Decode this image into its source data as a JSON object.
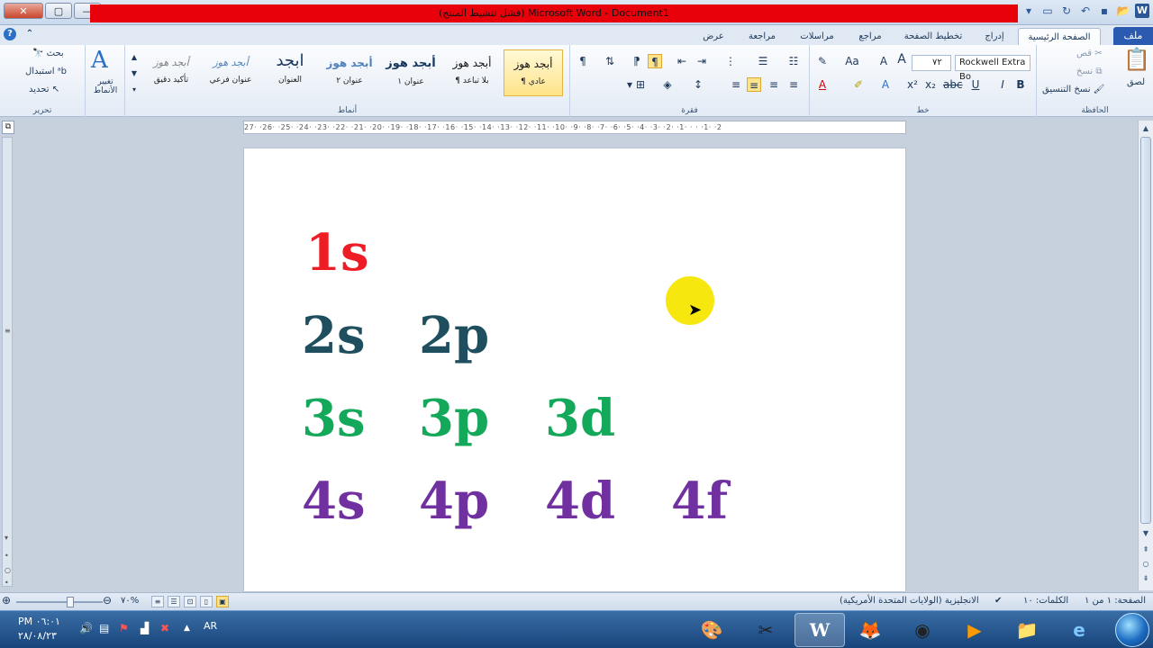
{
  "window": {
    "title": "(فشل تنشيط المنتج) Microsoft Word - Document1",
    "controls": [
      "✕",
      "▢",
      "—"
    ]
  },
  "tabs": {
    "file": "ملف",
    "home": "الصفحة الرئيسية",
    "insert": "إدراج",
    "layout": "تخطيط الصفحة",
    "references": "مراجع",
    "mailings": "مراسلات",
    "review": "مراجعة",
    "view": "عرض"
  },
  "ribbon": {
    "clipboard": {
      "label": "الحافظة",
      "paste": "لصق",
      "cut": "قص",
      "copy": "نسخ",
      "format_painter": "نسخ التنسيق"
    },
    "font": {
      "label": "خط",
      "name": "Rockwell Extra Bo",
      "size": "٧٢"
    },
    "paragraph": {
      "label": "فقرة"
    },
    "styles": {
      "label": "أنماط",
      "items": [
        {
          "preview": "أبجد هوز",
          "name": "¶ عادي"
        },
        {
          "preview": "أبجد هوز",
          "name": "¶ بلا تباعد"
        },
        {
          "preview": "أبجد هوز",
          "name": "عنوان ١"
        },
        {
          "preview": "أبجد هوز",
          "name": "عنوان ٢"
        },
        {
          "preview": "ابجد",
          "name": "العنوان"
        },
        {
          "preview": "أبجد هوز",
          "name": "عنوان فرعي"
        },
        {
          "preview": "أبجد هوز",
          "name": "تأكيد دقيق"
        }
      ],
      "change_styles": "تغيير الأنماط"
    },
    "editing": {
      "label": "تحرير",
      "find": "بحث",
      "replace": "استبدال",
      "select": "تحديد"
    }
  },
  "document": {
    "orbitals": [
      {
        "text": "1s",
        "color": "#ee1c25"
      },
      {
        "text": "2s",
        "color": "#1f4f5f"
      },
      {
        "text": "2p",
        "color": "#1f4f5f"
      },
      {
        "text": "3s",
        "color": "#14a95a"
      },
      {
        "text": "3p",
        "color": "#14a95a"
      },
      {
        "text": "3d",
        "color": "#14a95a"
      },
      {
        "text": "4s",
        "color": "#7030a0"
      },
      {
        "text": "4p",
        "color": "#7030a0"
      },
      {
        "text": "4d",
        "color": "#7030a0"
      },
      {
        "text": "4f",
        "color": "#7030a0"
      }
    ],
    "ruler_text": "27· ·26· ·25· ·24· ·23· ·22· ·21· ·20· ·19· ·18· ·17· ·16· ·15· ·14· ·13· ·12· ·11· ·10· ·9· ·8· ·7· ·6· ·5· ·4· ·3· ·2· ·1· · · ·1· ·2"
  },
  "status": {
    "page": "الصفحة: ١ من ١",
    "words": "الكلمات: ١٠",
    "language": "الانجليزية (الولايات المتحدة الأمريكية)",
    "zoom": "٧٠%"
  },
  "taskbar": {
    "time": "PM ٠٦:٠١",
    "date": "٢٨/٠٨/٢٣",
    "lang": "AR"
  },
  "colors": {
    "title_bar_accent": "#e8000a",
    "file_tab": "#2a5bb0",
    "highlight": "#f6e80e"
  }
}
